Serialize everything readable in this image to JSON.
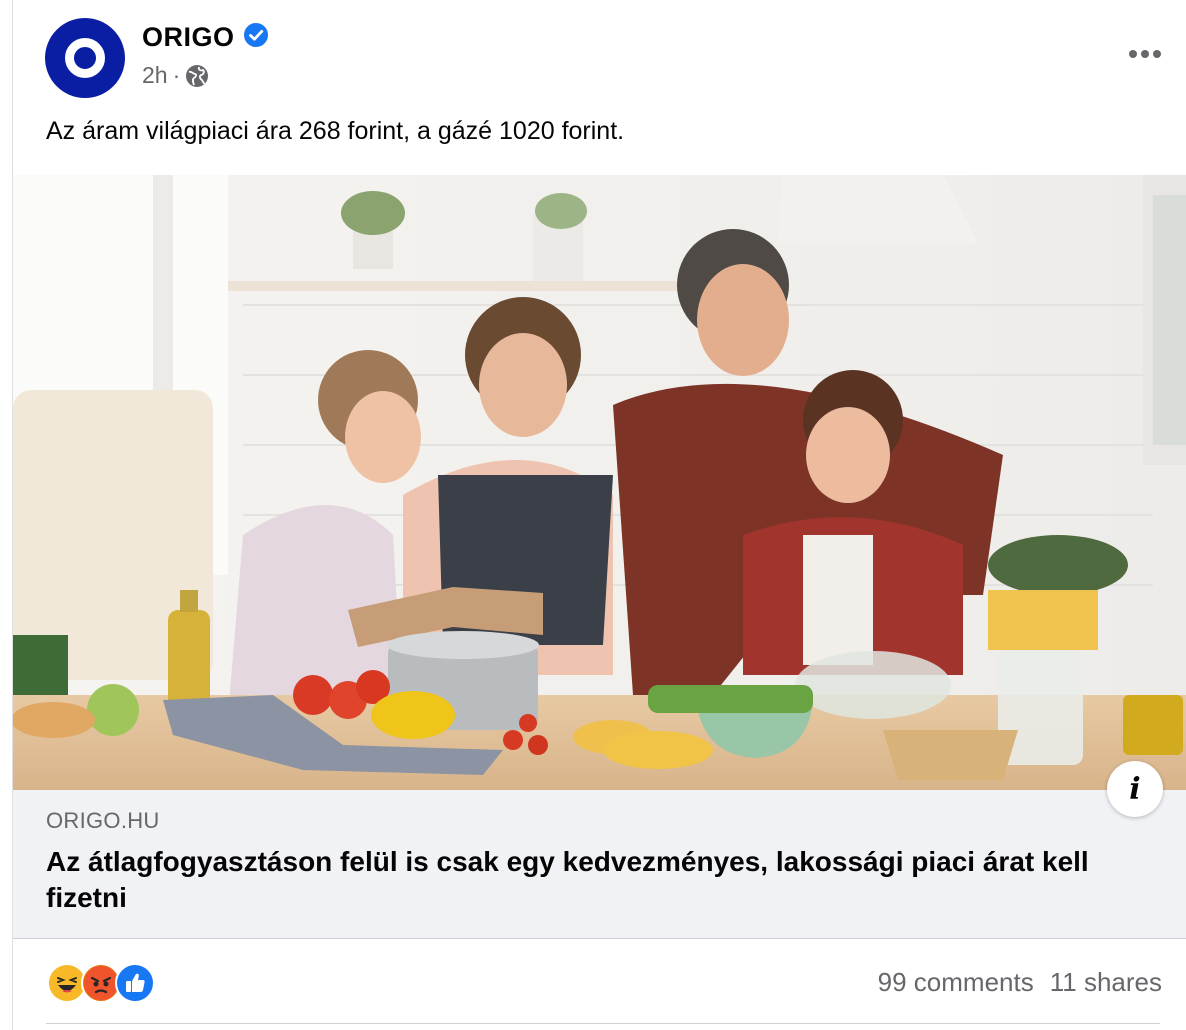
{
  "page": {
    "name": "ORIGO",
    "time": "2h",
    "separator": "·",
    "privacy_icon": "globe-icon",
    "verified_icon": "verified-badge-icon",
    "brand_color": "#0a1ea3"
  },
  "post": {
    "text": "Az áram világpiaci ára 268 forint, a gázé 1020 forint."
  },
  "link": {
    "domain": "ORIGO.HU",
    "title": "Az átlagfogyasztáson felül is csak egy kedvezményes, lakossági piaci árat kell fizetni",
    "info_label": "i"
  },
  "footer": {
    "reactions": [
      "haha-icon",
      "angry-icon",
      "like-icon"
    ],
    "comments": "99 comments",
    "shares": "11 shares"
  }
}
